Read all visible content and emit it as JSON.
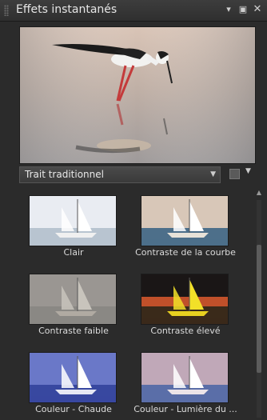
{
  "panel": {
    "title": "Effets instantanés",
    "menu_icon": "dropdown-arrow-icon",
    "pin_icon": "pin-icon",
    "close_icon": "close-icon"
  },
  "preview": {
    "subject": "stilt-bird-wading"
  },
  "preset_dropdown": {
    "selected": "Trait traditionnel"
  },
  "effects": [
    {
      "label": "Clair",
      "style": "light"
    },
    {
      "label": "Contraste de la courbe",
      "style": "curve"
    },
    {
      "label": "Contraste faible",
      "style": "lowcontrast"
    },
    {
      "label": "Contraste élevé",
      "style": "highcontrast"
    },
    {
      "label": "Couleur - Chaude",
      "style": "warm"
    },
    {
      "label": "Couleur - Lumière du ...",
      "style": "daylight"
    }
  ]
}
